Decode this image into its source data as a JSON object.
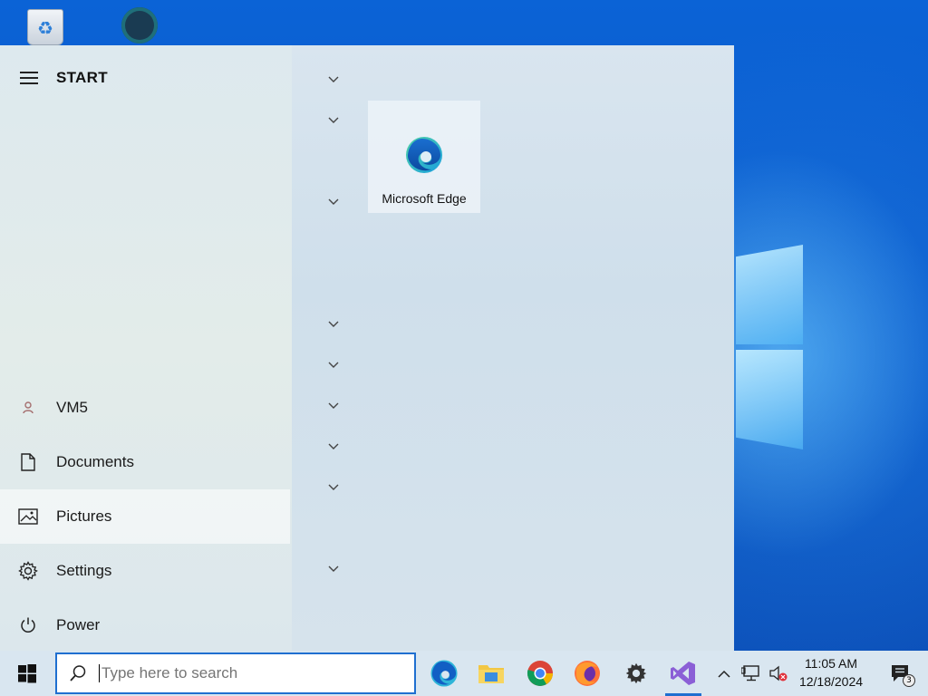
{
  "desktop": {
    "icons": [
      {
        "name": "recycle-bin-icon"
      },
      {
        "name": "vm-app-icon"
      }
    ]
  },
  "start_menu": {
    "title": "START",
    "nav": [
      {
        "label": "VM5",
        "icon": "user-icon"
      },
      {
        "label": "Documents",
        "icon": "document-icon"
      },
      {
        "label": "Pictures",
        "icon": "pictures-icon",
        "hovered": true
      },
      {
        "label": "Settings",
        "icon": "gear-icon"
      },
      {
        "label": "Power",
        "icon": "power-icon"
      }
    ],
    "tiles": [
      {
        "label": "Microsoft Edge",
        "icon": "edge-icon"
      }
    ]
  },
  "taskbar": {
    "search_placeholder": "Type here to search",
    "apps": [
      {
        "name": "edge",
        "icon": "edge-icon"
      },
      {
        "name": "file-explorer",
        "icon": "folder-icon"
      },
      {
        "name": "chrome",
        "icon": "chrome-icon"
      },
      {
        "name": "firefox",
        "icon": "firefox-icon"
      },
      {
        "name": "settings",
        "icon": "gear-icon"
      },
      {
        "name": "visual-studio",
        "icon": "visual-studio-icon",
        "active": true
      }
    ],
    "clock": {
      "time": "11:05 AM",
      "date": "12/18/2024"
    },
    "notifications": {
      "count": "3"
    }
  },
  "colors": {
    "accent": "#1f6fd0",
    "taskbar_bg": "#d9e6f0",
    "start_bg": "#dce7ec"
  }
}
